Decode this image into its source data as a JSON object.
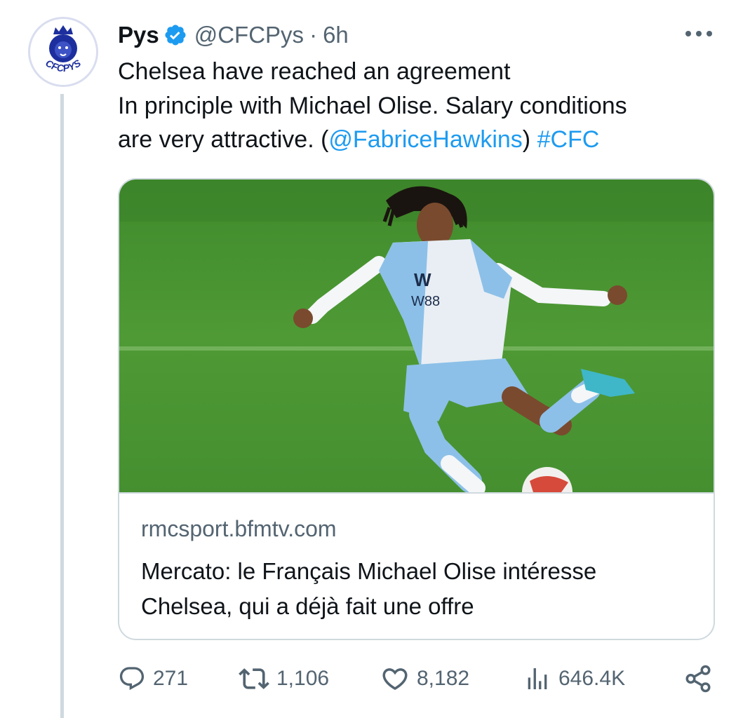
{
  "tweet": {
    "author": {
      "name": "Pys",
      "handle": "@CFCPys",
      "verified": true,
      "avatar_text": "CFCPYS"
    },
    "separator": "·",
    "time": "6h",
    "text_lines": [
      [
        {
          "t": "Chelsea have reached an agreement"
        }
      ],
      [
        {
          "t": "In principle with Michael Olise. Salary conditions"
        }
      ],
      [
        {
          "t": "are very attractive. ("
        },
        {
          "t": "@FabriceHawkins",
          "link": true
        },
        {
          "t": ") "
        },
        {
          "t": "#CFC",
          "link": true
        }
      ]
    ],
    "card": {
      "image_alt": "Footballer in a light blue and white kit striking a ball on a grass pitch",
      "shirt_text": "W88",
      "domain": "rmcsport.bfmtv.com",
      "title_lines": [
        "Mercato: le Français Michael Olise intéresse",
        "Chelsea, qui a déjà fait une offre"
      ]
    },
    "actions": {
      "replies": "271",
      "reposts": "1,106",
      "likes": "8,182",
      "views": "646.4K"
    }
  },
  "colors": {
    "link": "#1d9bf0",
    "verified": "#1d9bf0",
    "muted": "#536471",
    "border": "#cfd9de",
    "avatar_brand": "#1d2f9e"
  },
  "icons": {
    "more": "more-horizontal-icon",
    "verified": "verified-badge-icon",
    "reply": "reply-icon",
    "repost": "repost-icon",
    "like": "heart-icon",
    "views": "views-icon",
    "share": "share-icon"
  }
}
